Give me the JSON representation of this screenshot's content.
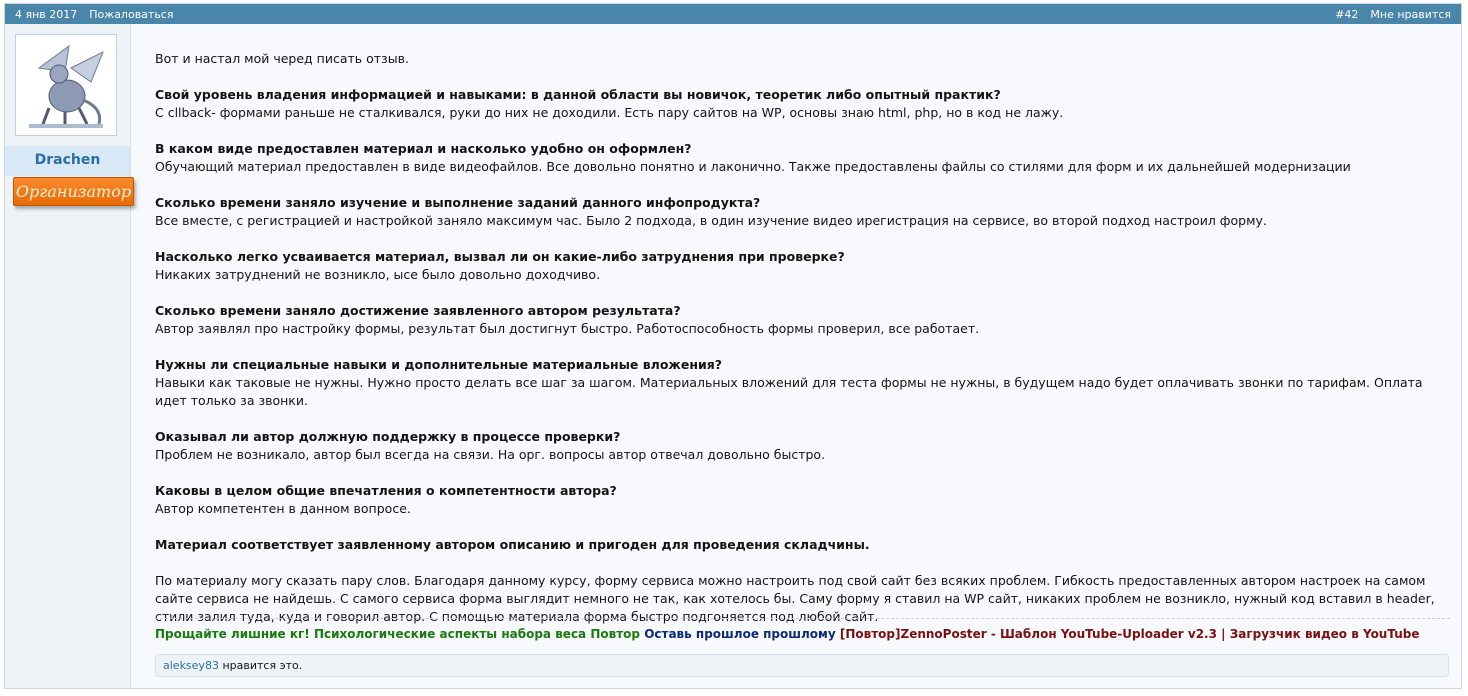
{
  "header": {
    "date": "4 янв 2017",
    "report": "Пожаловаться",
    "post_number": "#42",
    "like": "Мне нравится"
  },
  "user": {
    "name": "Drachen",
    "role": "Организатор"
  },
  "body": {
    "intro": "Вот и настал мой черед писать отзыв.",
    "qa": [
      {
        "q": "Свой уровень владения информацией и навыками: в данной области вы новичок, теоретик либо опытный практик?",
        "a": "С cllback- формами раньше не сталкивался, руки до них не доходили. Есть пару сайтов на WP, основы знаю html, php, но в код не лажу."
      },
      {
        "q": "В каком виде предоставлен материал и насколько удобно он оформлен?",
        "a": "Обучающий материал предоставлен в виде видеофайлов. Все довольно понятно и лаконично. Также предоставлены файлы со стилями для форм и их дальнейшей модернизации"
      },
      {
        "q": "Сколько времени заняло изучение и выполнение заданий данного инфопродукта?",
        "a": "Все вместе, с регистрацией и настройкой заняло максимум час. Было 2 подхода, в один изучение видео ирегистрация на сервисе, во второй подход настроил форму."
      },
      {
        "q": "Насколько легко усваивается материал, вызвал ли он какие-либо затруднения при проверке?",
        "a": "Никаких затруднений не возникло, ысе было довольно доходчиво."
      },
      {
        "q": "Сколько времени заняло достижение заявленного автором результата?",
        "a": "Автор заявлял про настройку формы, результат был достигнут быстро. Работоспособность формы проверил, все работает."
      },
      {
        "q": "Нужны ли специальные навыки и дополнительные материальные вложения?",
        "a": "Навыки как таковые не нужны. Нужно просто делать все шаг за шагом. Материальных вложений для теста формы не нужны, в будущем надо будет оплачивать звонки по тарифам. Оплата идет только за звонки."
      },
      {
        "q": "Оказывал ли автор должную поддержку в процессе проверки?",
        "a": "Проблем не возникало, автор был всегда на связи. На орг. вопросы автор отвечал довольно быстро."
      },
      {
        "q": "Каковы в целом общие впечатления о компетентности автора?",
        "a": "Автор компетентен в данном вопросе."
      }
    ],
    "conclusion": "Материал соответствует заявленному автором описанию и пригоден для проведения складчины.",
    "final": "По материалу могу сказать пару слов. Благодаря данному курсу, форму сервиса можно настроить под свой сайт без всяких проблем. Гибкость предоставленных автором настроек на самом сайте сервиса не найдешь. С самого сервиса форма выглядит немного не так, как хотелось бы. Саму форму я ставил на WP сайт, никаких проблем не возникло, нужный код вставил в header, стили залил туда, куда и говорил автор. С помощью материала форма быстро подгоняется под любой сайт."
  },
  "signature": {
    "link1": "Прощайте лишние кг! Психологические аспекты набора веса Повтор",
    "link2": "Оставь прошлое прошлому",
    "link3": "[Повтор]ZennoPoster - Шаблон YouTube-Uploader v2.3 | Загрузчик видео в YouTube"
  },
  "likes": {
    "user": "aleksey83",
    "text": " нравится это."
  },
  "colors": {
    "header_bg": "#4a85aa",
    "badge": "#f07a16",
    "username": "#2b6ea3"
  }
}
